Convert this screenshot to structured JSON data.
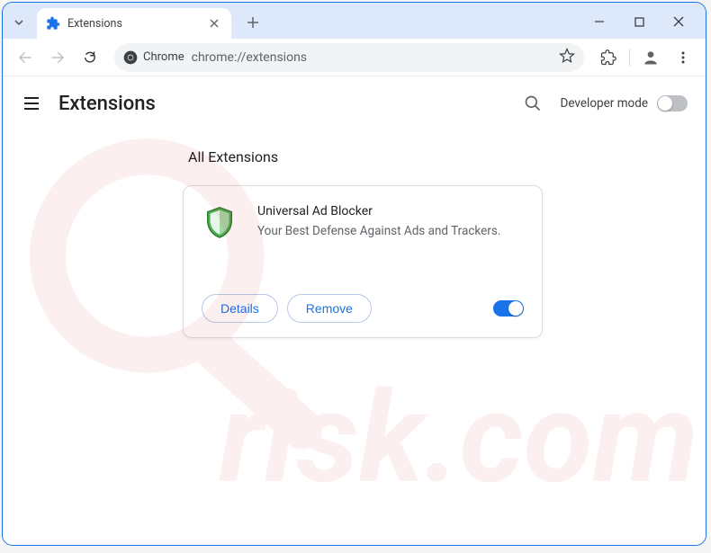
{
  "window": {
    "tab_title": "Extensions"
  },
  "toolbar": {
    "chrome_label": "Chrome",
    "url": "chrome://extensions"
  },
  "page": {
    "title": "Extensions",
    "dev_mode_label": "Developer mode",
    "dev_mode_on": false,
    "section_title": "All Extensions"
  },
  "extension": {
    "name": "Universal Ad Blocker",
    "description": "Your Best Defense Against Ads and Trackers.",
    "details_label": "Details",
    "remove_label": "Remove",
    "enabled": true
  }
}
